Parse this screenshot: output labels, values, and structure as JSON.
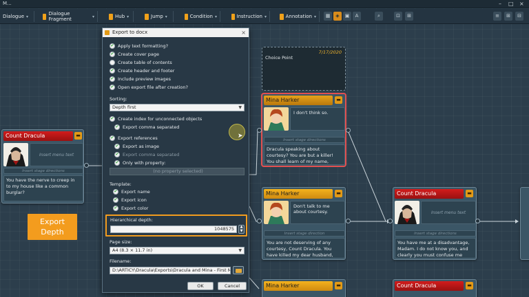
{
  "window": {
    "title": "M..."
  },
  "toolbar": {
    "items": [
      {
        "label": "Dialogue",
        "icon": "dialogue-icon"
      },
      {
        "label": "Dialogue Fragment",
        "icon": "fragment-icon"
      },
      {
        "label": "Hub",
        "icon": "hub-icon"
      },
      {
        "label": "Jump",
        "icon": "jump-icon"
      },
      {
        "label": "Condition",
        "icon": "condition-icon"
      },
      {
        "label": "Instruction",
        "icon": "instruction-icon"
      },
      {
        "label": "Annotation",
        "icon": "annotation-icon"
      }
    ]
  },
  "nodes": {
    "dracula_left": {
      "speaker": "Count Dracula",
      "menu_text": "Insert menu text",
      "stage": "Insert stage directions",
      "text": "You have the nerve to creep in to my house like a common burglar?"
    },
    "choice_point": {
      "date": "7/17/2020",
      "label": "Choice Point"
    },
    "mina_top": {
      "speaker": "Mina Harker",
      "line": "I don't think so.",
      "stage": "Insert stage directions",
      "text": "Dracula speaking about courtesy? You are but a killer! You shall learn of my name,"
    },
    "mina_mid": {
      "speaker": "Mina Harker",
      "line": "Don't talk to me about courtesy.",
      "stage": "Insert stage direction",
      "text": "You are not deserving of any courtesy, Count Dracula. You have killed my dear husband,"
    },
    "dracula_right": {
      "speaker": "Count Dracula",
      "menu_text": "Insert menu text",
      "stage": "Insert stage directions",
      "text": "You have me at a disadvantage, Madam. I do not know you, and clearly you must confuse me"
    },
    "mina_bottom": {
      "speaker": "Mina Harker"
    },
    "dracula_bottom": {
      "speaker": "Count Dracula"
    }
  },
  "callout": {
    "line1": "Export",
    "line2": "Depth"
  },
  "dialog": {
    "title": "Export to docx",
    "options": [
      {
        "label": "Apply text formatting?",
        "checked": true
      },
      {
        "label": "Create cover page",
        "checked": true
      },
      {
        "label": "Create table of contents",
        "checked": false
      },
      {
        "label": "Create header and footer",
        "checked": true
      },
      {
        "label": "Include preview images",
        "checked": true
      },
      {
        "label": "Open export file after creation?",
        "checked": true
      }
    ],
    "sorting_label": "Sorting:",
    "sorting_value": "Depth first",
    "index": {
      "label": "Create index for unconnected objects",
      "checked": true
    },
    "index_comma": {
      "label": "Export comma separated",
      "checked": true
    },
    "refs": {
      "label": "Export references",
      "checked": true
    },
    "refs_image": {
      "label": "Export as image",
      "checked": true
    },
    "refs_comma": {
      "label": "Export comma separated",
      "checked": true
    },
    "refs_prop": {
      "label": "Only with property:",
      "checked": true
    },
    "property_placeholder": "(no property selected)",
    "template_label": "Template:",
    "template": [
      {
        "label": "Export name",
        "checked": true
      },
      {
        "label": "Export icon",
        "checked": true
      },
      {
        "label": "Export color",
        "checked": true
      }
    ],
    "depth_label": "Hierarchical depth:",
    "depth_value": "1048575",
    "page_size_label": "Page size:",
    "page_size_value": "A4 (8.3 × 11.7 in)",
    "filename_label": "Filename:",
    "filename_value": "D:\\ARTICY\\Dracula\\Exports\\Dracula and Mina - First Meeting",
    "ok": "OK",
    "cancel": "Cancel"
  },
  "colors": {
    "accent": "#f39c1e",
    "speaker_red": "#c41818",
    "speaker_gold": "#f0a81c",
    "canvas": "#2c3e4c"
  }
}
